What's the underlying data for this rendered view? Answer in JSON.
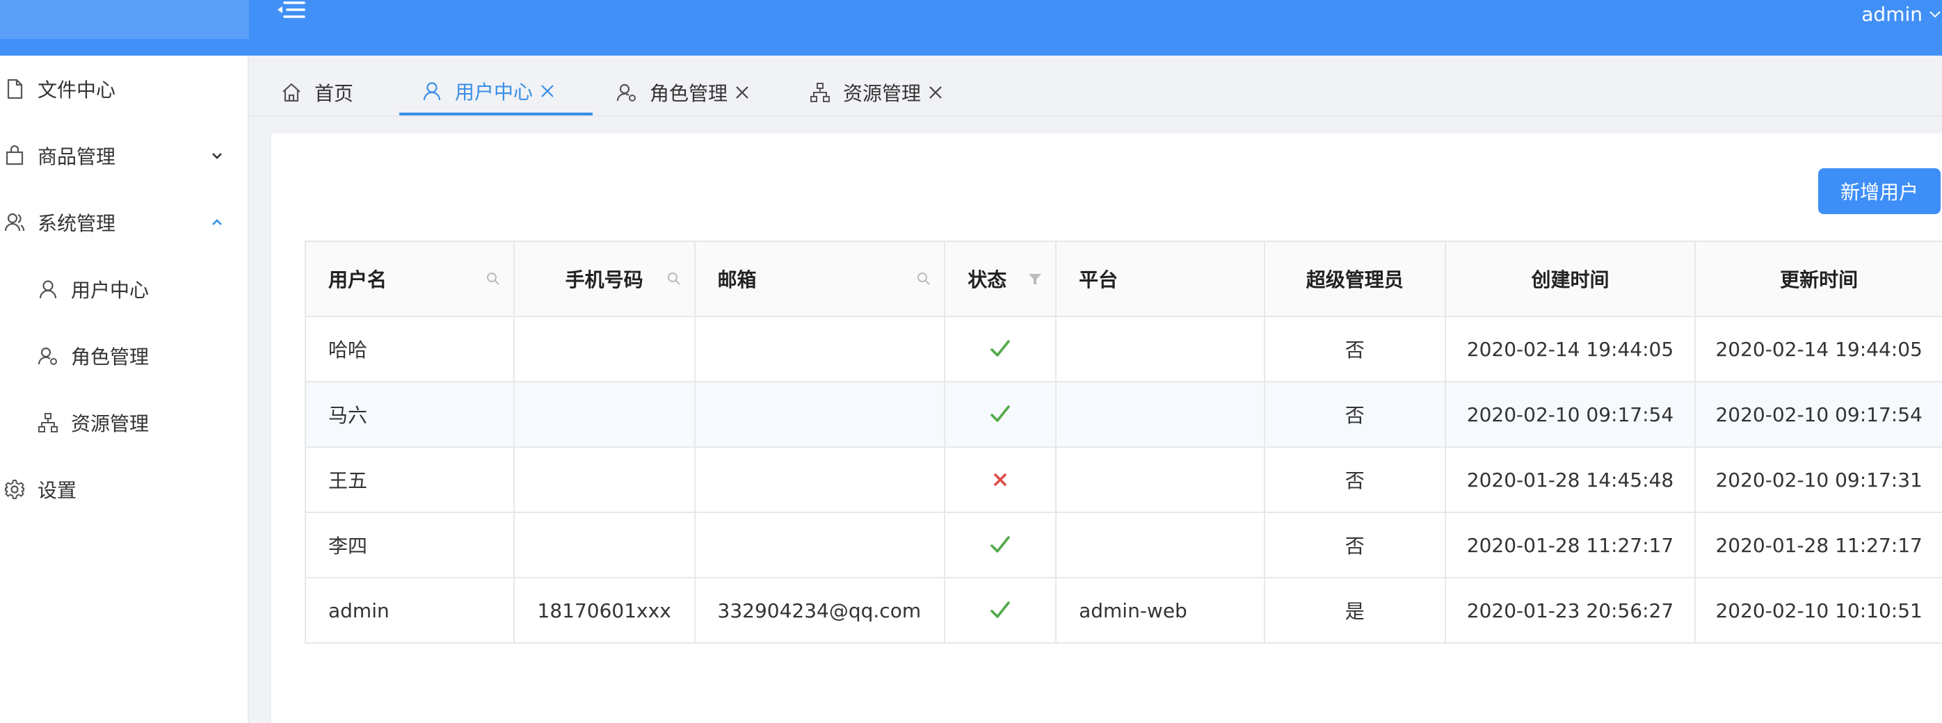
{
  "header": {
    "user_label": "admin",
    "colors": {
      "primary": "#4190f7",
      "success": "#52a94a",
      "danger": "#e04b4b"
    }
  },
  "sidebar": {
    "items": [
      {
        "label": "文件中心",
        "icon": "file-icon"
      },
      {
        "label": "商品管理",
        "icon": "shopping-bag-icon",
        "expanded": false
      },
      {
        "label": "系统管理",
        "icon": "users-icon",
        "expanded": true
      },
      {
        "label": "用户中心",
        "icon": "user-icon"
      },
      {
        "label": "角色管理",
        "icon": "role-icon"
      },
      {
        "label": "资源管理",
        "icon": "sitemap-icon"
      },
      {
        "label": "设置",
        "icon": "gear-icon"
      }
    ]
  },
  "tabs": [
    {
      "label": "首页",
      "icon": "home-icon",
      "closable": false,
      "active": false
    },
    {
      "label": "用户中心",
      "icon": "user-icon",
      "closable": true,
      "active": true
    },
    {
      "label": "角色管理",
      "icon": "role-icon",
      "closable": true,
      "active": false
    },
    {
      "label": "资源管理",
      "icon": "sitemap-icon",
      "closable": true,
      "active": false
    }
  ],
  "toolbar": {
    "add_user_label": "新增用户"
  },
  "table": {
    "columns": [
      "用户名",
      "手机号码",
      "邮箱",
      "状态",
      "平台",
      "超级管理员",
      "创建时间",
      "更新时间"
    ],
    "rows": [
      {
        "username": "哈哈",
        "phone": "",
        "email": "",
        "status": true,
        "platform": "",
        "super_admin": "否",
        "created": "2020-02-14 19:44:05",
        "updated": "2020-02-14 19:44:05"
      },
      {
        "username": "马六",
        "phone": "",
        "email": "",
        "status": true,
        "platform": "",
        "super_admin": "否",
        "created": "2020-02-10 09:17:54",
        "updated": "2020-02-10 09:17:54"
      },
      {
        "username": "王五",
        "phone": "",
        "email": "",
        "status": false,
        "platform": "",
        "super_admin": "否",
        "created": "2020-01-28 14:45:48",
        "updated": "2020-02-10 09:17:31"
      },
      {
        "username": "李四",
        "phone": "",
        "email": "",
        "status": true,
        "platform": "",
        "super_admin": "否",
        "created": "2020-01-28 11:27:17",
        "updated": "2020-01-28 11:27:17"
      },
      {
        "username": "admin",
        "phone": "18170601xxx",
        "email": "332904234@qq.com",
        "status": true,
        "platform": "admin-web",
        "super_admin": "是",
        "created": "2020-01-23 20:56:27",
        "updated": "2020-02-10 10:10:51"
      }
    ]
  }
}
